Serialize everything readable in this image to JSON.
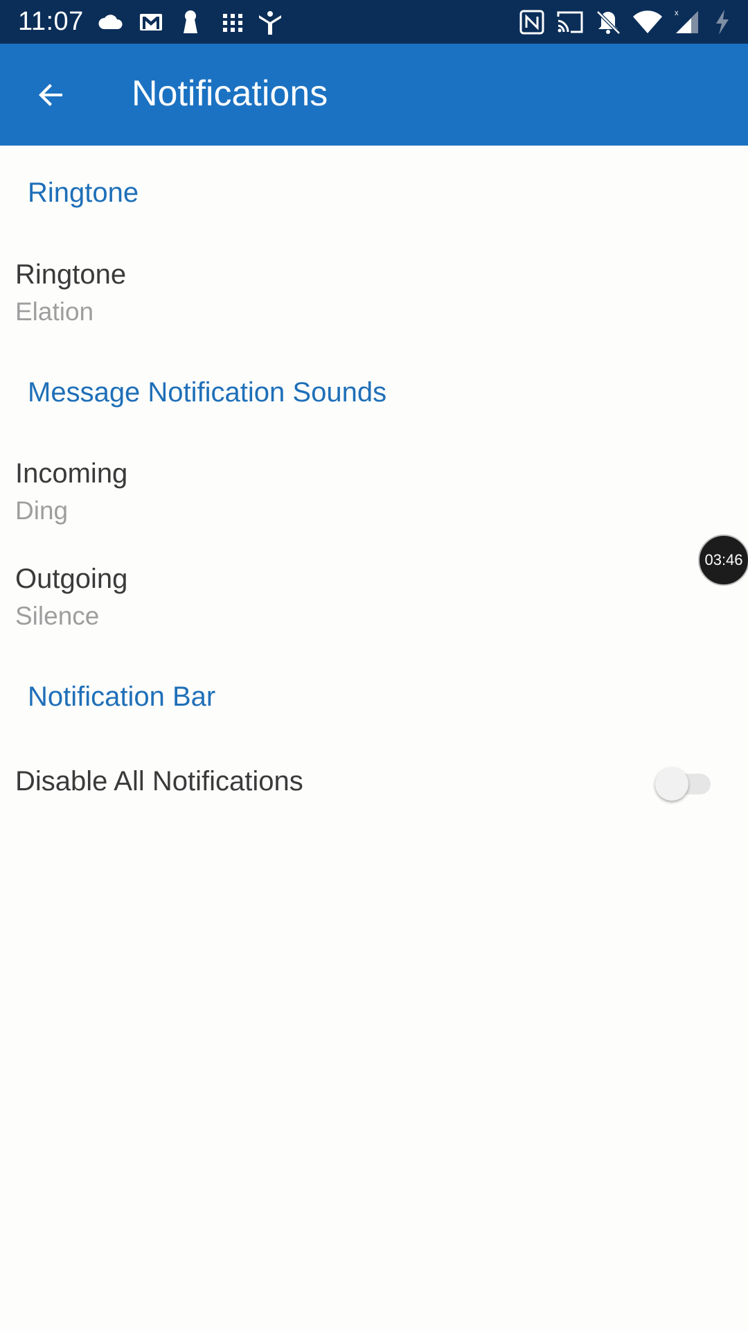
{
  "status_bar": {
    "time": "11:07",
    "left_icons": [
      "cloud-icon",
      "gmail-icon",
      "keyhole-icon",
      "grid-icon",
      "figure-icon"
    ],
    "right_icons": [
      "nfc-icon",
      "cast-icon",
      "bell-off-icon",
      "wifi-icon",
      "signal-icon",
      "battery-charging-icon"
    ],
    "background_color": "#0b2e58"
  },
  "app_bar": {
    "title": "Notifications",
    "back_icon": "arrow-back-icon",
    "background_color": "#1c72c2"
  },
  "sections": [
    {
      "header": "Ringtone",
      "items": [
        {
          "title": "Ringtone",
          "summary": "Elation"
        }
      ]
    },
    {
      "header": "Message Notification Sounds",
      "items": [
        {
          "title": "Incoming",
          "summary": "Ding"
        },
        {
          "title": "Outgoing",
          "summary": "Silence"
        }
      ]
    },
    {
      "header": "Notification Bar",
      "items": [
        {
          "title": "Disable All Notifications",
          "toggle_on": false
        }
      ]
    }
  ],
  "timer_bubble": {
    "text": "03:46"
  },
  "colors": {
    "accent": "#1f6fb8",
    "title_text": "#3a3a3a",
    "summary_text": "#9e9e9e"
  }
}
